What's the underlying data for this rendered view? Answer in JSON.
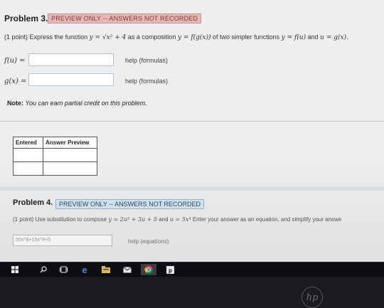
{
  "problem3": {
    "title": "Problem 3.",
    "badge": "PREVIEW ONLY -- ANSWERS NOT RECORDED",
    "points": "(1 point)",
    "text_1": "Express the function",
    "fn_y": "y = ",
    "fn_rhs": "√x² + 4",
    "text_2": "as a composition",
    "comp": "y = f(g(x))",
    "text_3": "of two simpler functions",
    "f_of_u": "y = f(u)",
    "text_and": "and",
    "g_of_x": "u = g(x).",
    "label_f": "f(u) =",
    "label_g": "g(x) =",
    "help_label": "help (formulas)",
    "note_bold": "Note:",
    "note_text": "You can earn partial credit on this problem.",
    "table_headers": [
      "Entered",
      "Answer Preview"
    ]
  },
  "problem4": {
    "title": "Problem 4.",
    "badge": "PREVIEW ONLY -- ANSWERS NOT RECORDED",
    "points": "(1 point)",
    "text_1": "Use substitution to compose",
    "expr_y": "y = 2u² + 3u + 5",
    "text_and": "and",
    "expr_u": "u = 5x⁴",
    "text_2": "Enter your answer as an equation, and simplify your answe",
    "answer_value": "50x^8+15x^4+5",
    "help_label": "help (equations)"
  },
  "taskbar": {
    "icons": [
      "windows-start-icon",
      "search-icon",
      "task-view-icon",
      "edge-browser-icon",
      "file-explorer-icon",
      "mail-icon",
      "chrome-icon",
      "pinned-app-icon"
    ]
  },
  "hardware": {
    "logo_text": "hp"
  },
  "colors": {
    "badge_red_bg": "#e6b9b4",
    "badge_blue_bg": "#d7e5f2",
    "taskbar_bg": "#0d0e11"
  }
}
